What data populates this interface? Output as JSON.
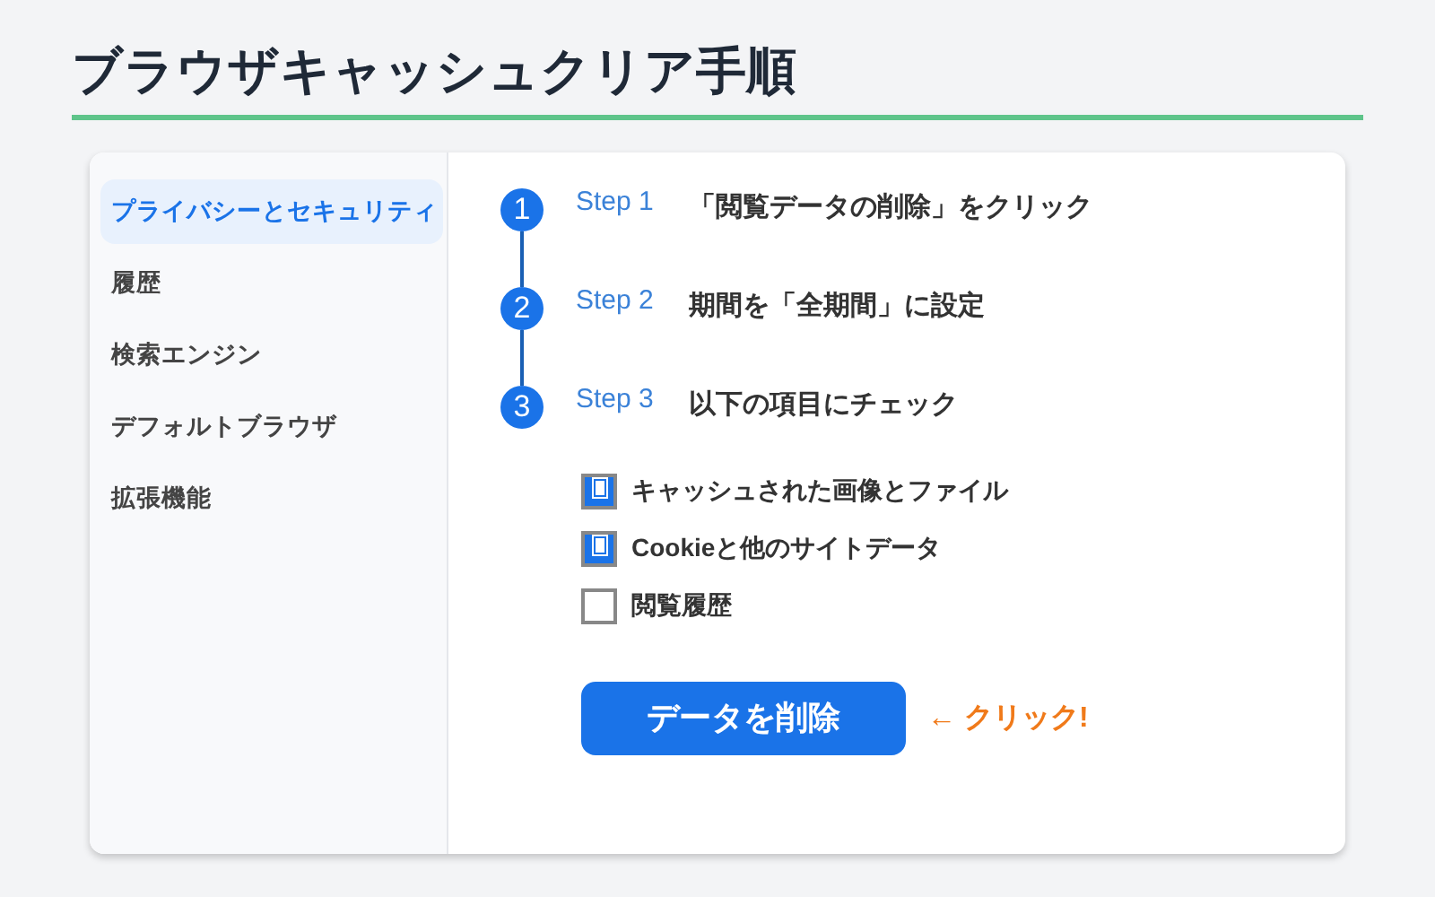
{
  "title": "ブラウザキャッシュクリア手順",
  "sidebar": {
    "items": [
      {
        "label": "プライバシーとセキュリティ",
        "selected": true
      },
      {
        "label": "履歴",
        "selected": false
      },
      {
        "label": "検索エンジン",
        "selected": false
      },
      {
        "label": "デフォルトブラウザ",
        "selected": false
      },
      {
        "label": "拡張機能",
        "selected": false
      }
    ]
  },
  "steps": [
    {
      "number": "1",
      "label": "Step 1",
      "text": "「閲覧データの削除」をクリック"
    },
    {
      "number": "2",
      "label": "Step 2",
      "text": "期間を「全期間」に設定"
    },
    {
      "number": "3",
      "label": "Step 3",
      "text": "以下の項目にチェック"
    }
  ],
  "options": [
    {
      "label": "キャッシュされた画像とファイル",
      "checked": true
    },
    {
      "label": "Cookieと他のサイトデータ",
      "checked": true
    },
    {
      "label": "閲覧履歴",
      "checked": false
    }
  ],
  "button": "データを削除",
  "hint": "← クリック!"
}
